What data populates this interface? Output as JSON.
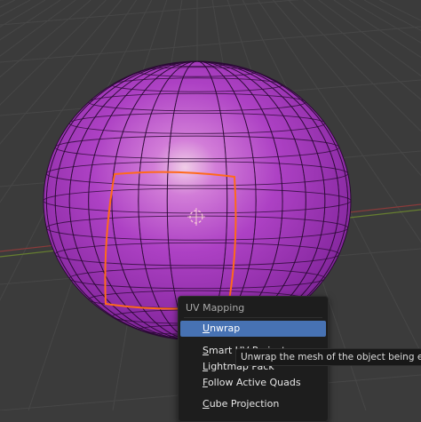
{
  "viewport": {
    "object": "uv-sphere",
    "colors": {
      "background": "#3b3b3b",
      "grid_line": "#474747",
      "x_axis": "#8a3b3b",
      "y_axis": "#6e8a2f",
      "mesh_face": "#a236b8",
      "mesh_wire": "#2b0a35",
      "selection": "#ff6a1a",
      "origin": "#f6c7d6"
    }
  },
  "uv_menu": {
    "title": "UV Mapping",
    "items": [
      {
        "label": "Unwrap",
        "mnemonic": "U",
        "active": true
      },
      {
        "label": "Smart UV Project",
        "mnemonic": "S",
        "active": false
      },
      {
        "label": "Lightmap Pack",
        "mnemonic": "L",
        "active": false
      },
      {
        "label": "Follow Active Quads",
        "mnemonic": "F",
        "active": false
      },
      {
        "label": "Cube Projection",
        "mnemonic": "C",
        "active": false
      }
    ]
  },
  "tooltip": {
    "text": "Unwrap the mesh of the object being edited"
  }
}
